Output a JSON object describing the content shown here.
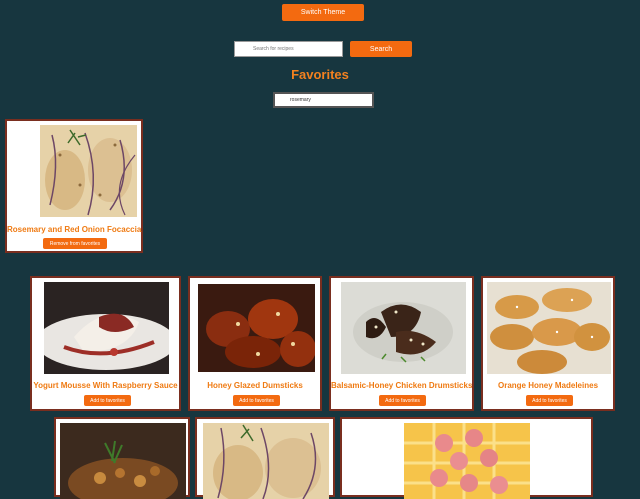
{
  "header": {
    "switch_theme_label": "Switch Theme"
  },
  "search": {
    "placeholder": "Search for recipes",
    "button_label": "Search"
  },
  "favorites": {
    "heading": "Favorites",
    "filter_value": "rosemary",
    "cards": [
      {
        "title": "Rosemary and Red Onion Focaccia",
        "button_label": "Remove from favorites"
      }
    ]
  },
  "recipes": {
    "cards": [
      {
        "title": "Yogurt Mousse With Raspberry Sauce",
        "button_label": "Add to favorites"
      },
      {
        "title": "Honey Glazed Dumsticks",
        "button_label": "Add to favorites"
      },
      {
        "title": "Balsamic-Honey Chicken Drumsticks",
        "button_label": "Add to favorites"
      },
      {
        "title": "Orange Honey Madeleines",
        "button_label": "Add to favorites"
      }
    ]
  },
  "colors": {
    "background": "#17363f",
    "accent": "#f36a10",
    "title": "#ef7a12",
    "card_border": "#7a2e1f"
  }
}
